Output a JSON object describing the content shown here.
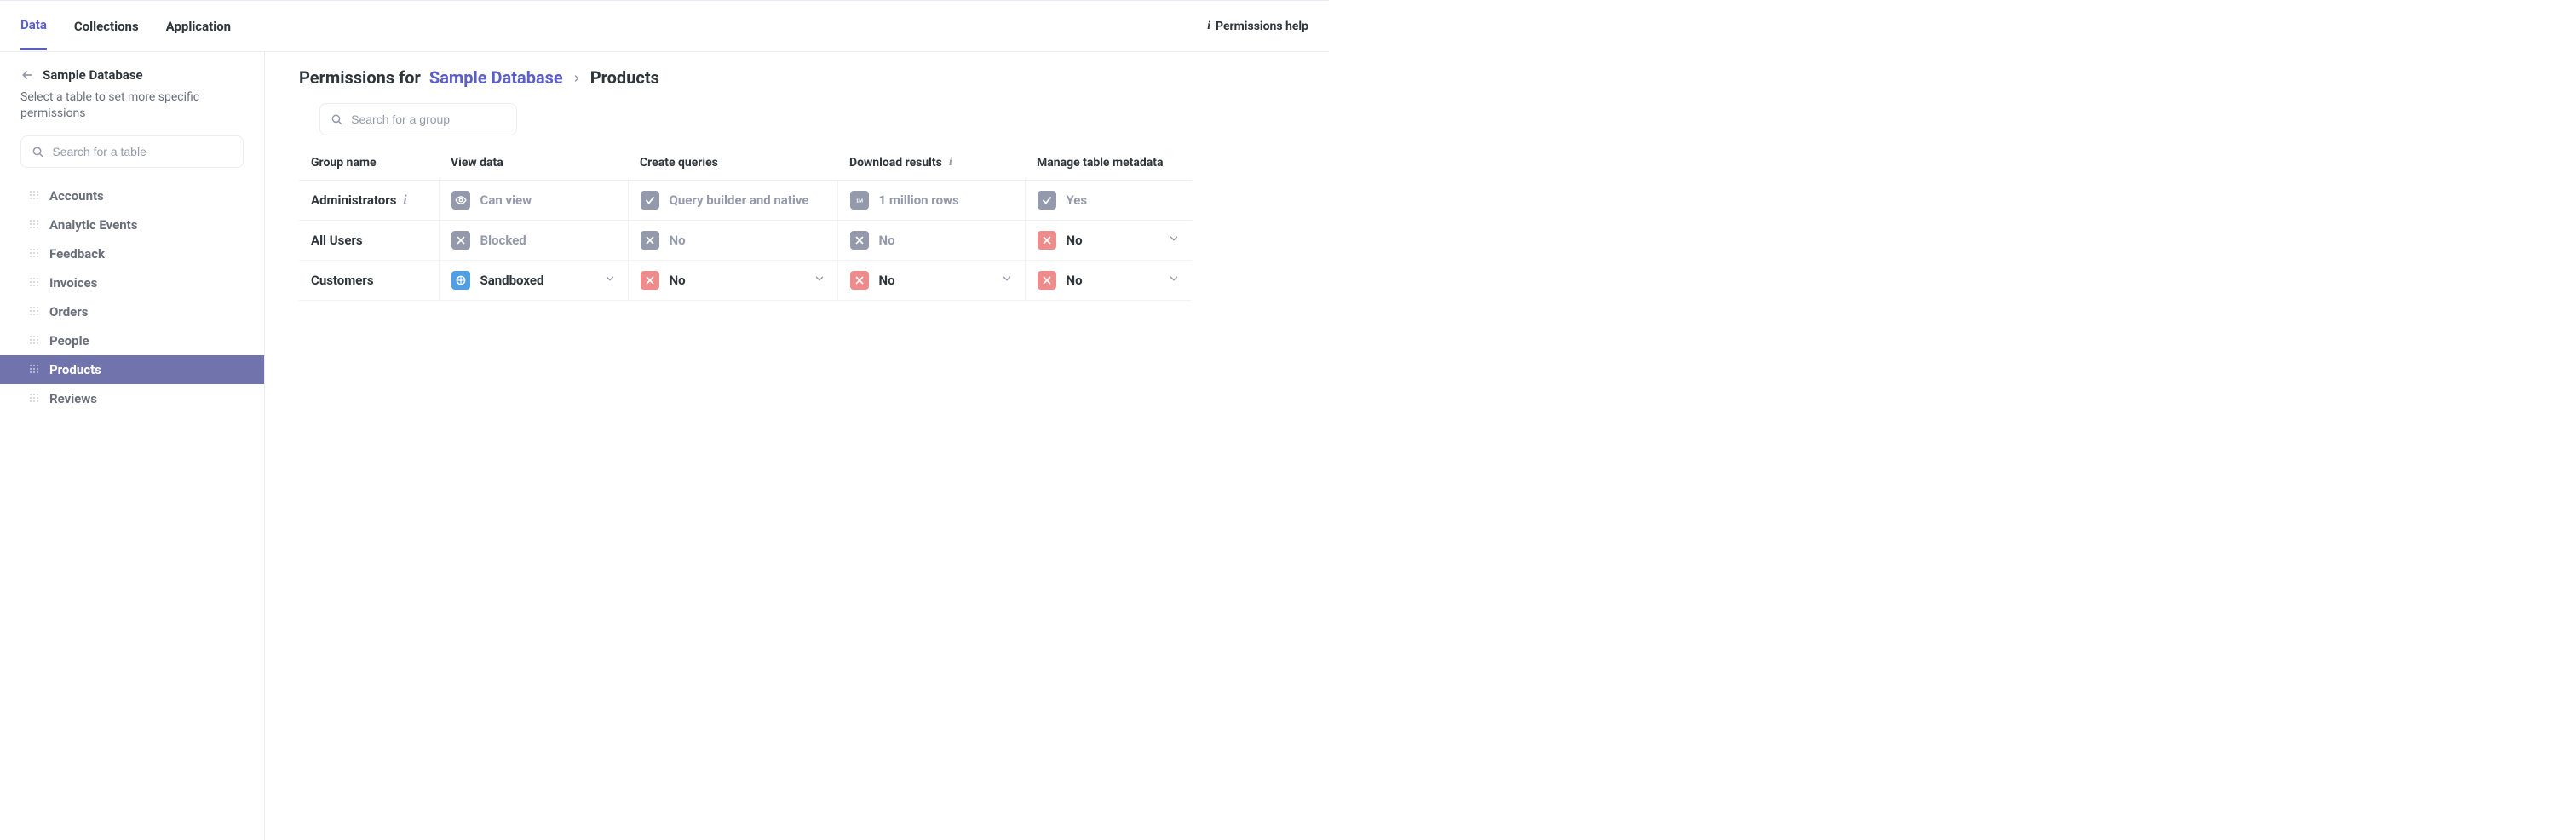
{
  "nav": {
    "tabs": [
      "Data",
      "Collections",
      "Application"
    ],
    "active": 0,
    "help_label": "Permissions help"
  },
  "sidebar": {
    "title": "Sample Database",
    "subtitle": "Select a table to set more specific permissions",
    "search_placeholder": "Search for a table",
    "items": [
      "Accounts",
      "Analytic Events",
      "Feedback",
      "Invoices",
      "Orders",
      "People",
      "Products",
      "Reviews"
    ],
    "active_index": 6
  },
  "breadcrumb": {
    "prefix": "Permissions for",
    "db": "Sample Database",
    "table": "Products"
  },
  "group_search_placeholder": "Search for a group",
  "columns": {
    "group": "Group name",
    "view": "View data",
    "create": "Create queries",
    "download": "Download results",
    "manage": "Manage table metadata"
  },
  "rows": [
    {
      "name": "Administrators",
      "name_info": true,
      "view": {
        "icon": "eye",
        "color": "gray",
        "label": "Can view",
        "muted": true,
        "dropdown": false
      },
      "create": {
        "icon": "check",
        "color": "gray",
        "label": "Query builder and native",
        "muted": true,
        "dropdown": false
      },
      "download": {
        "icon": "1m",
        "color": "gray",
        "label": "1 million rows",
        "muted": true,
        "dropdown": false
      },
      "manage": {
        "icon": "check",
        "color": "gray",
        "label": "Yes",
        "muted": true,
        "dropdown": false
      }
    },
    {
      "name": "All Users",
      "view": {
        "icon": "x",
        "color": "gray",
        "label": "Blocked",
        "muted": true,
        "dropdown": false
      },
      "create": {
        "icon": "x",
        "color": "gray",
        "label": "No",
        "muted": true,
        "dropdown": false
      },
      "download": {
        "icon": "x",
        "color": "gray",
        "label": "No",
        "muted": true,
        "dropdown": false
      },
      "manage": {
        "icon": "x",
        "color": "red",
        "label": "No",
        "muted": false,
        "dropdown": true
      }
    },
    {
      "name": "Customers",
      "view": {
        "icon": "sandbox",
        "color": "blue",
        "label": "Sandboxed",
        "muted": false,
        "dropdown": true
      },
      "create": {
        "icon": "x",
        "color": "red",
        "label": "No",
        "muted": false,
        "dropdown": true
      },
      "download": {
        "icon": "x",
        "color": "red",
        "label": "No",
        "muted": false,
        "dropdown": true
      },
      "manage": {
        "icon": "x",
        "color": "red",
        "label": "No",
        "muted": false,
        "dropdown": true
      }
    }
  ]
}
